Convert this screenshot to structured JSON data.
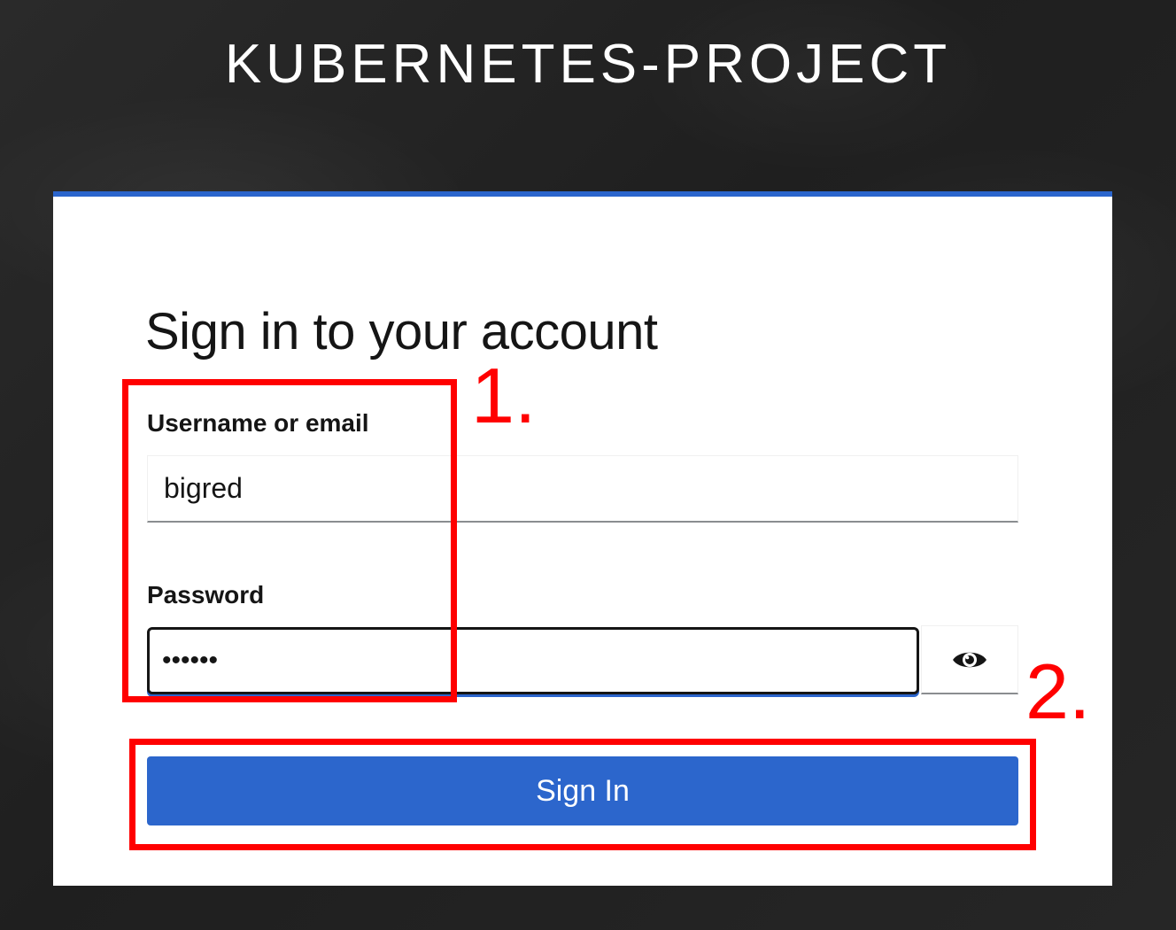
{
  "page": {
    "realm_title": "KUBERNETES-PROJECT"
  },
  "login": {
    "heading": "Sign in to your account",
    "username_label": "Username or email",
    "username_value": "bigred",
    "password_label": "Password",
    "password_value": "bigred",
    "show_password_icon": "eye-icon",
    "submit_label": "Sign In"
  },
  "annotations": {
    "step_1": "1.",
    "step_2": "2.",
    "color": "#ff0000"
  },
  "colors": {
    "background": "#242424",
    "card": "#ffffff",
    "accent": "#2b65cc",
    "button": "#2c66cc",
    "text": "#151515"
  }
}
